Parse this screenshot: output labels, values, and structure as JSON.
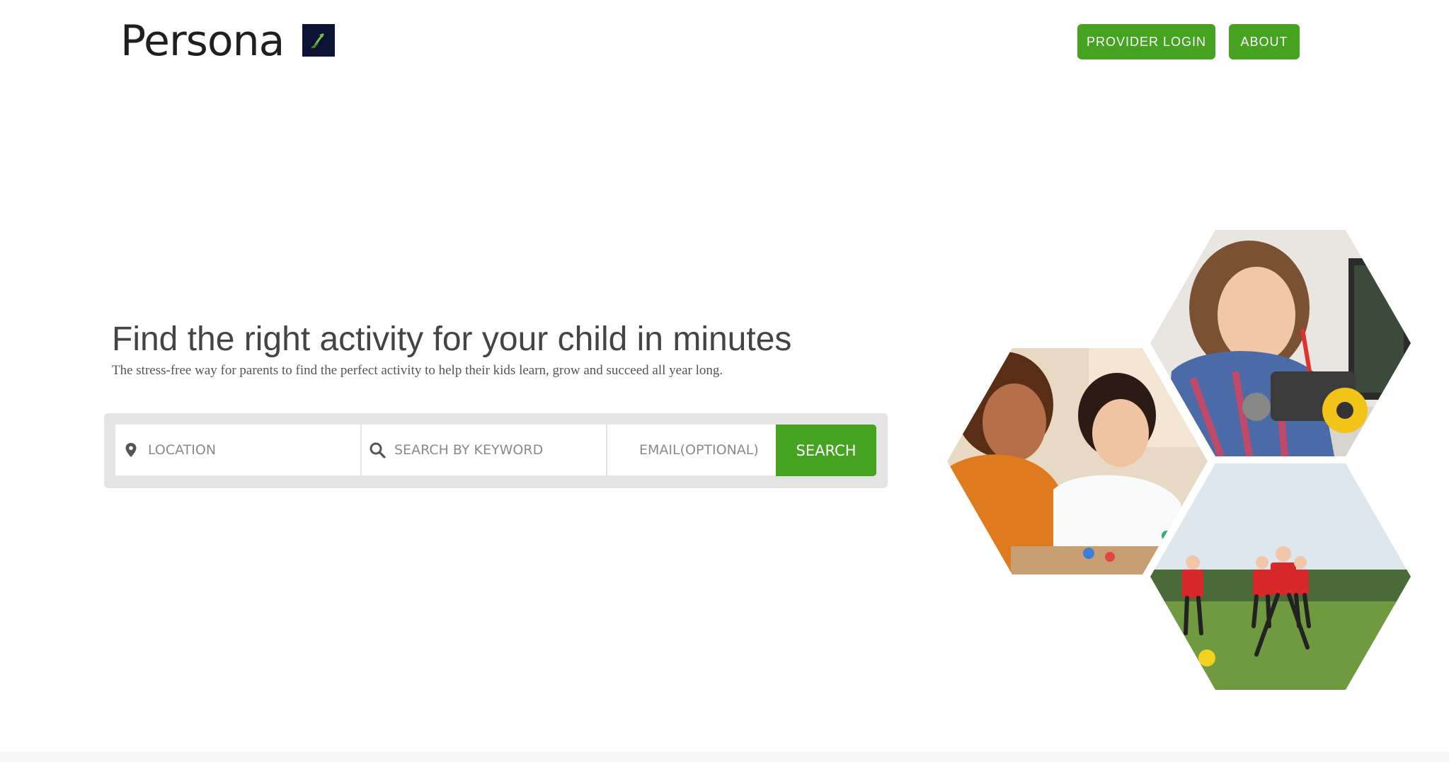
{
  "header": {
    "logo_text": "Persona",
    "logo_mark_icon": "leaf-arrow-icon",
    "provider_login_label": "PROVIDER LOGIN",
    "about_label": "ABOUT"
  },
  "hero": {
    "headline": "Find the right activity for your child in minutes",
    "subline": "The stress-free way for parents to find the perfect activity to help their kids learn, grow and succeed all year long."
  },
  "search": {
    "location_placeholder": "LOCATION",
    "keyword_placeholder": "SEARCH BY KEYWORD",
    "email_placeholder": "EMAIL(OPTIONAL)",
    "button_label": "SEARCH",
    "location_icon": "map-pin-icon",
    "keyword_icon": "search-icon"
  },
  "images": [
    {
      "name": "girl-robotics-photo"
    },
    {
      "name": "mother-daughter-crafts-photo"
    },
    {
      "name": "kids-soccer-photo"
    }
  ],
  "colors": {
    "accent_green": "#46a321",
    "logo_bg": "#0c1233",
    "search_bg": "#e4e4e4",
    "text": "#444444"
  }
}
